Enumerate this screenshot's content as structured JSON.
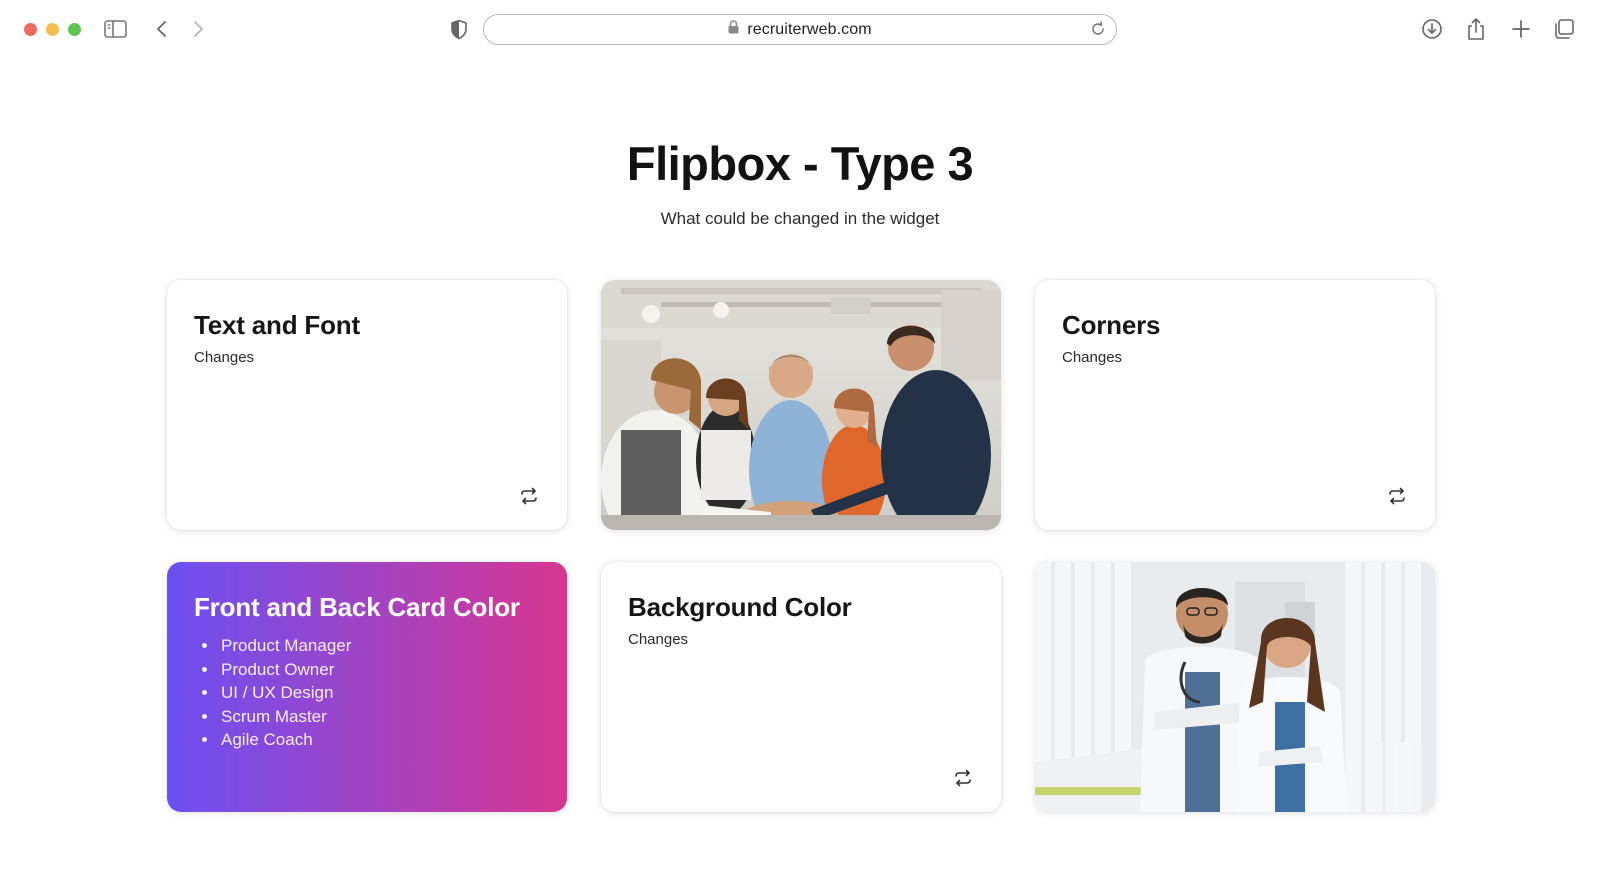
{
  "browser": {
    "url": "recruiterweb.com"
  },
  "page": {
    "title": "Flipbox - Type 3",
    "subtitle": "What could be changed in the widget"
  },
  "cards": [
    {
      "title": "Text and Font",
      "subtitle": "Changes",
      "icon": "flip-icon"
    },
    {
      "image": "team-hands-photo"
    },
    {
      "title": "Corners",
      "subtitle": "Changes",
      "icon": "flip-icon"
    },
    {
      "title": "Front and Back Card Color",
      "items": [
        "Product Manager",
        "Product Owner",
        "UI / UX Design",
        "Scrum Master",
        "Agile Coach"
      ],
      "gradient": [
        "#6c4ff2",
        "#d8368f"
      ]
    },
    {
      "title": "Background Color",
      "subtitle": "Changes",
      "icon": "flip-icon"
    },
    {
      "image": "doctors-photo"
    }
  ]
}
